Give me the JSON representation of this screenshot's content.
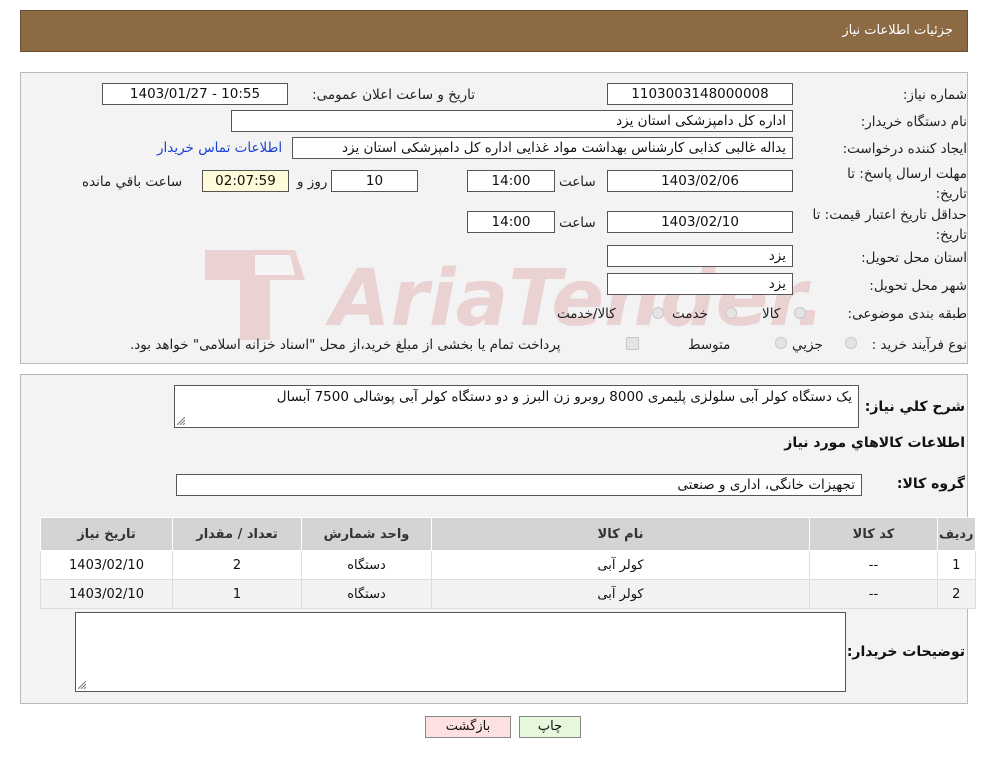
{
  "header": {
    "title": "جزئیات اطلاعات نیاز"
  },
  "fields": {
    "need_number_label": "شماره نیاز:",
    "need_number": "1103003148000008",
    "announce_label": "تاریخ و ساعت اعلان عمومی:",
    "announce_value": "1403/01/27 - 10:55",
    "buyer_org_label": "نام دستگاه خریدار:",
    "buyer_org": "اداره کل دامپزشکی استان یزد",
    "creator_label": "ایجاد کننده درخواست:",
    "creator": "یداله غالبی کذابی کارشناس بهداشت مواد غذایی اداره کل دامپزشکی استان یزد",
    "contact_link": "اطلاعات تماس خریدار",
    "deadline_label": "مهلت ارسال پاسخ: تا تاریخ:",
    "deadline_date": "1403/02/06",
    "hour_label": "ساعت",
    "deadline_time": "14:00",
    "days_value": "10",
    "days_label": "روز و",
    "remaining_time": "02:07:59",
    "remaining_label": "ساعت باقي مانده",
    "validity_label": "حداقل تاریخ اعتبار قیمت: تا تاریخ:",
    "validity_date": "1403/02/10",
    "validity_time": "14:00",
    "province_label": "استان محل تحویل:",
    "province": "یزد",
    "city_label": "شهر محل تحویل:",
    "city": "یزد",
    "category_label": "طبقه بندی موضوعی:",
    "cat_goods": "کالا",
    "cat_service": "خدمت",
    "cat_goods_service": "کالا/خدمت",
    "process_label": "نوع فرآیند خرید :",
    "proc_partial": "جزيي",
    "proc_medium": "متوسط",
    "payment_note": "پرداخت تمام یا بخشی از مبلغ خرید،از محل \"اسناد خزانه اسلامی\" خواهد بود."
  },
  "details": {
    "summary_label": "شرح كلي نياز:",
    "summary": "یک دستگاه کولر آبی سلولزی پلیمری 8000 روبرو زن البرز و دو دستگاه کولر آبی پوشالی 7500 آبسال",
    "goods_info_title": "اطلاعات كالاهاي مورد نياز",
    "goods_group_label": "گروه کالا:",
    "goods_group": "تجهیزات خانگی، اداری و صنعتی",
    "buyer_notes_label": "توضيحات خريدار:"
  },
  "table": {
    "headers": [
      "ردیف",
      "کد کالا",
      "نام کالا",
      "واحد شمارش",
      "تعداد / مقدار",
      "تاریخ نیاز"
    ],
    "rows": [
      [
        "1",
        "--",
        "کولر آبی",
        "دستگاه",
        "2",
        "1403/02/10"
      ],
      [
        "2",
        "--",
        "کولر آبی",
        "دستگاه",
        "1",
        "1403/02/10"
      ]
    ]
  },
  "buttons": {
    "print": "چاپ",
    "back": "بازگشت"
  },
  "watermark": "AriaTender.neT",
  "colors": {
    "header": "#8b6a44",
    "print_btn": "#e6f8dc",
    "back_btn": "#fde0e0",
    "link": "#1a3fd8"
  }
}
